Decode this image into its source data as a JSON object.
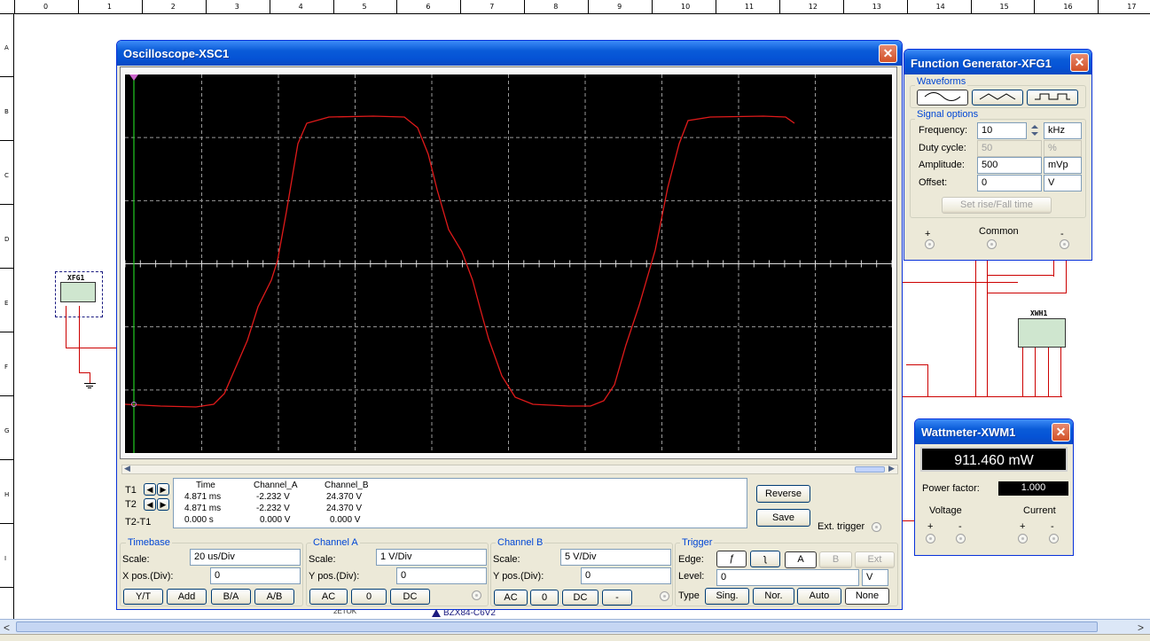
{
  "ruler": {
    "columns": [
      "0",
      "1",
      "2",
      "3",
      "4",
      "5",
      "6",
      "7",
      "8",
      "9",
      "10",
      "11",
      "12",
      "13",
      "14",
      "15",
      "16",
      "17"
    ],
    "rows": [
      "A",
      "B",
      "C",
      "D",
      "E",
      "F",
      "G",
      "H",
      "I"
    ]
  },
  "schematic": {
    "xfg1_label": "XFG1",
    "xwm1_label": "XWH1",
    "bottom_part_label": "BZX84-C6V2",
    "partial_label": "2ETOK"
  },
  "oscilloscope": {
    "title": "Oscilloscope-XSC1",
    "close": "✕",
    "trace_color": "#e01a1a",
    "cursor_color": "#22cc22",
    "readout": {
      "headers": [
        "Time",
        "Channel_A",
        "Channel_B"
      ],
      "t1": {
        "label": "T1",
        "time": "4.871 ms",
        "a": "-2.232 V",
        "b": "24.370 V"
      },
      "t2": {
        "label": "T2",
        "time": "4.871 ms",
        "a": "-2.232 V",
        "b": "24.370 V"
      },
      "diff": {
        "label": "T2-T1",
        "time": "0.000 s",
        "a": "0.000 V",
        "b": "0.000 V"
      }
    },
    "reverse_label": "Reverse",
    "save_label": "Save",
    "ext_trigger_label": "Ext. trigger",
    "timebase": {
      "title": "Timebase",
      "scale_label": "Scale:",
      "scale_value": "20 us/Div",
      "xpos_label": "X pos.(Div):",
      "xpos_value": "0",
      "buttons": [
        "Y/T",
        "Add",
        "B/A",
        "A/B"
      ]
    },
    "channel_a": {
      "title": "Channel A",
      "scale_label": "Scale:",
      "scale_value": "1  V/Div",
      "ypos_label": "Y pos.(Div):",
      "ypos_value": "0",
      "buttons": [
        "AC",
        "0",
        "DC"
      ]
    },
    "channel_b": {
      "title": "Channel B",
      "scale_label": "Scale:",
      "scale_value": "5  V/Div",
      "ypos_label": "Y pos.(Div):",
      "ypos_value": "0",
      "buttons": [
        "AC",
        "0",
        "DC",
        "-"
      ]
    },
    "trigger": {
      "title": "Trigger",
      "edge_label": "Edge:",
      "source_buttons": [
        "A",
        "B",
        "Ext"
      ],
      "level_label": "Level:",
      "level_value": "0",
      "level_unit": "V",
      "type_label": "Type",
      "type_buttons": [
        "Sing.",
        "Nor.",
        "Auto",
        "None"
      ]
    }
  },
  "function_generator": {
    "title": "Function Generator-XFG1",
    "close": "✕",
    "waveforms_title": "Waveforms",
    "signal_options_title": "Signal options",
    "frequency_label": "Frequency:",
    "frequency_value": "10",
    "frequency_unit": "kHz",
    "duty_label": "Duty cycle:",
    "duty_value": "50",
    "duty_unit": "%",
    "amplitude_label": "Amplitude:",
    "amplitude_value": "500",
    "amplitude_unit": "mVp",
    "offset_label": "Offset:",
    "offset_value": "0",
    "offset_unit": "V",
    "rise_fall_label": "Set rise/Fall time",
    "plus_label": "+",
    "common_label": "Common",
    "minus_label": "-"
  },
  "wattmeter": {
    "title": "Wattmeter-XWM1",
    "close": "✕",
    "reading": "911.460 mW",
    "power_factor_label": "Power factor:",
    "power_factor_value": "1.000",
    "voltage_label": "Voltage",
    "current_label": "Current",
    "plus": "+",
    "minus": "-"
  }
}
